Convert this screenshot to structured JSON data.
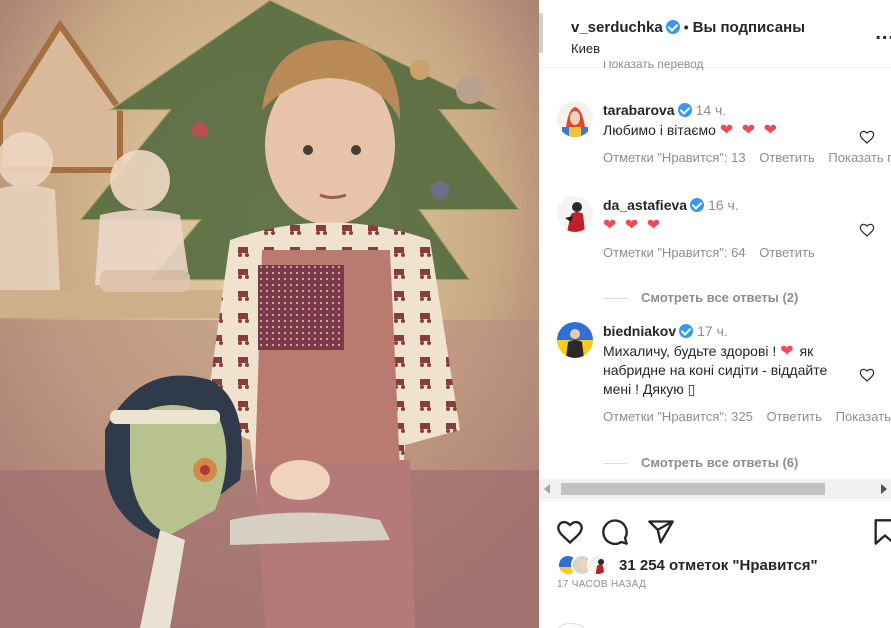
{
  "post": {
    "photo_alt": "",
    "header": {
      "username": "v_serduchka",
      "separator": "•",
      "follow_status": "Вы подписаны",
      "location": "Киев",
      "more_label": "..."
    },
    "translate_cut": "Показать перевод",
    "comments": [
      {
        "username": "tarabarova",
        "verified": true,
        "time": "14 ч.",
        "text": "Любимо і вітаємо",
        "hearts": "❤ ❤ ❤",
        "likes": "Отметки \"Нравится\": 13",
        "reply": "Ответить",
        "translate": "Показать перевод"
      },
      {
        "username": "da_astafieva",
        "verified": true,
        "time": "16 ч.",
        "text": "",
        "hearts": "❤ ❤ ❤",
        "likes": "Отметки \"Нравится\": 64",
        "reply": "Ответить",
        "view_replies": "Смотреть все ответы (2)"
      },
      {
        "username": "biedniakov",
        "verified": true,
        "time": "17 ч.",
        "text_part1": "Михаличу, будьте здорові !",
        "text_part2": "як набридне на коні сидіти - віддайте мені ! Дякую",
        "missing_glyph": "▯",
        "likes": "Отметки \"Нравится\": 325",
        "reply": "Ответить",
        "translate": "Показать перевод",
        "view_replies": "Смотреть все ответы (6)"
      }
    ],
    "likes_count_text": "31 254 отметок \"Нравится\"",
    "time_ago": "17 ЧАСОВ НАЗАД",
    "icons": {
      "like": "heart-icon",
      "comment": "comment-icon",
      "share": "share-icon",
      "save": "bookmark-icon"
    },
    "colors": {
      "verified": "#3897f0",
      "heart": "#ed4956",
      "muted": "#8e8e8e"
    }
  }
}
